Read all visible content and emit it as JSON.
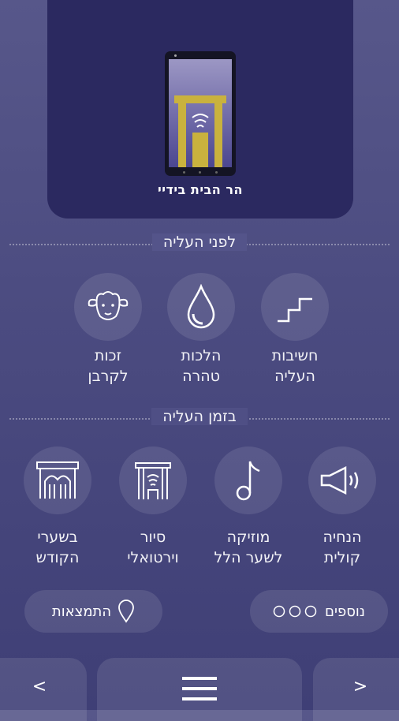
{
  "app": {
    "title": "הר הבית בידיי"
  },
  "section_before": {
    "title": "לפני העליה",
    "items": [
      {
        "label_line1": "חשיבות",
        "label_line2": "העליה",
        "icon": "stairs-icon"
      },
      {
        "label_line1": "הלכות",
        "label_line2": "טהרה",
        "icon": "water-drop-icon"
      },
      {
        "label_line1": "זכות",
        "label_line2": "לקרבן",
        "icon": "sheep-icon"
      }
    ]
  },
  "section_during": {
    "title": "בזמן העליה",
    "items": [
      {
        "label_line1": "הנחיה",
        "label_line2": "קולית",
        "icon": "speaker-icon"
      },
      {
        "label_line1": "מוזיקה",
        "label_line2": "לשער הלל",
        "icon": "music-note-icon"
      },
      {
        "label_line1": "סיור",
        "label_line2": "וירטואלי",
        "icon": "gate-wifi-icon"
      },
      {
        "label_line1": "בשערי",
        "label_line2": "הקודש",
        "icon": "arch-gate-icon"
      }
    ]
  },
  "footer_buttons": {
    "more_label": "נוספים",
    "location_label": "התמצאות"
  },
  "bottom_nav": {
    "prev": "<",
    "next": ">",
    "menu_icon": "hamburger-icon"
  },
  "colors": {
    "background": "#4b4b80",
    "hero": "#2b2960",
    "gold": "#c9b23e"
  }
}
